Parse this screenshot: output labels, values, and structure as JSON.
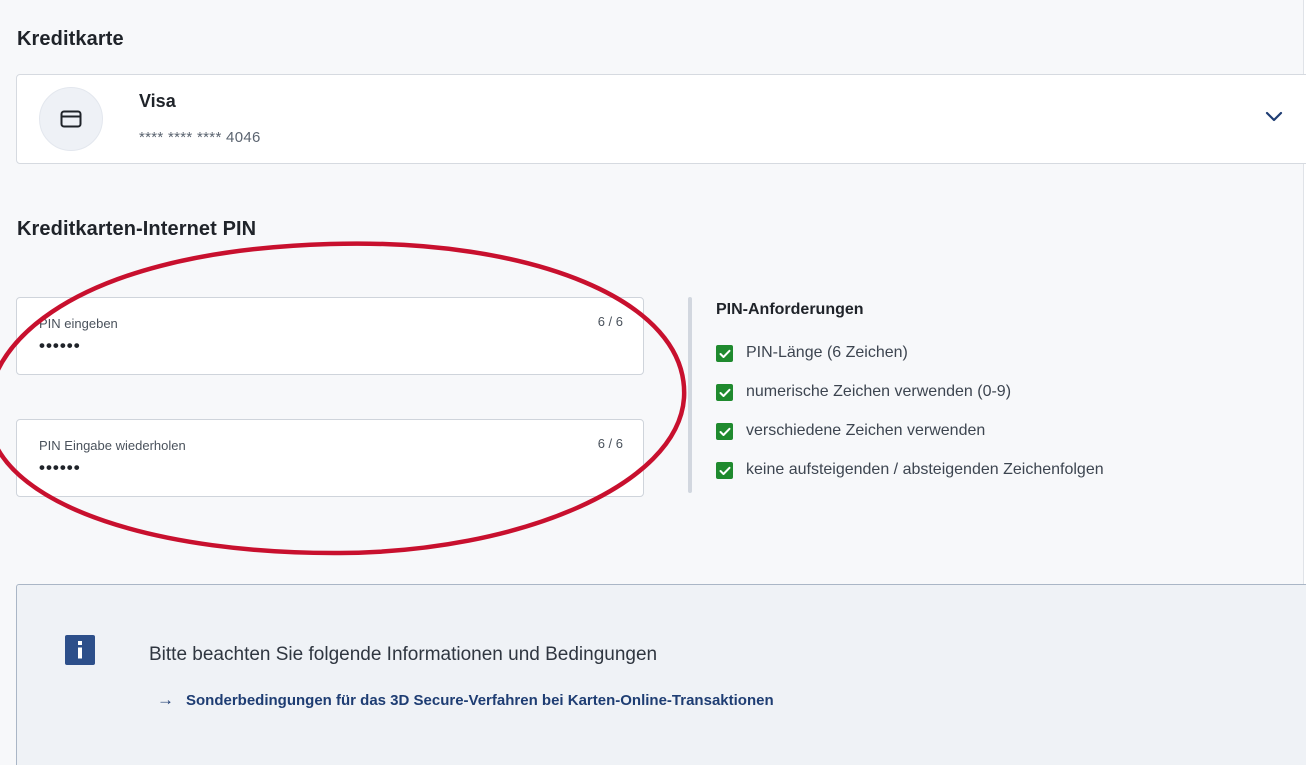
{
  "credit_card_section": {
    "title": "Kreditkarte",
    "selected_card": {
      "name": "Visa",
      "number": "**** **** **** 4046",
      "icon": "credit-card-icon",
      "expand_icon": "chevron-down-icon"
    }
  },
  "pin_section": {
    "title": "Kreditkarten-Internet PIN",
    "pin_input": {
      "label": "PIN eingeben",
      "counter": "6 / 6",
      "value": "••••••"
    },
    "pin_repeat_input": {
      "label": "PIN Eingabe wiederholen",
      "counter": "6 / 6",
      "value": "••••••"
    }
  },
  "requirements": {
    "title": "PIN-Anforderungen",
    "items": [
      {
        "label": "PIN-Länge (6 Zeichen)",
        "met": true
      },
      {
        "label": "numerische Zeichen verwenden (0-9)",
        "met": true
      },
      {
        "label": "verschiedene Zeichen verwenden",
        "met": true
      },
      {
        "label": "keine aufsteigenden / absteigenden Zeichenfolgen",
        "met": true
      }
    ]
  },
  "info_box": {
    "icon": "info-icon",
    "text": "Bitte beachten Sie folgende Informationen und Bedingungen",
    "link_label": "Sonderbedingungen für das 3D Secure-Verfahren bei Karten-Online-Transaktionen"
  },
  "colors": {
    "accent": "#1e3d73",
    "check_green": "#1f8a2e",
    "annotation_red": "#c8102e"
  }
}
